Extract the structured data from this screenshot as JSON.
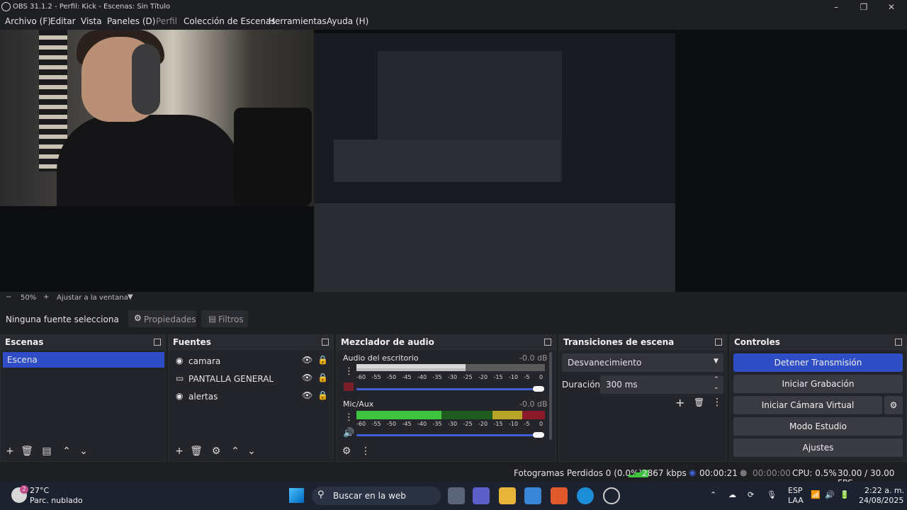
{
  "window": {
    "title": "OBS 31.1.2 - Perfil: Kick - Escenas: Sin Título"
  },
  "menu": [
    "Archivo (F)",
    "Editar",
    "Vista",
    "Paneles (D)",
    "Perfil",
    "Colección de Escenas",
    "Herramientas",
    "Ayuda (H)"
  ],
  "zoom": {
    "minus": "−",
    "value": "50%",
    "plus": "+",
    "mode": "Ajustar a la ventana"
  },
  "source_bar": {
    "no_source": "Ninguna fuente selecciona",
    "properties": "Propiedades",
    "filters": "Filtros"
  },
  "scenes": {
    "title": "Escenas",
    "items": [
      "Escena"
    ]
  },
  "sources": {
    "title": "Fuentes",
    "items": [
      {
        "name": "camara",
        "icon": "camera-icon"
      },
      {
        "name": "PANTALLA GENERAL",
        "icon": "monitor-icon"
      },
      {
        "name": "alertas",
        "icon": "globe-icon"
      }
    ]
  },
  "mixer": {
    "title": "Mezclador de audio",
    "channels": [
      {
        "name": "Audio del escritorio",
        "db": "-0.0 dB",
        "level": 0.58
      },
      {
        "name": "Mic/Aux",
        "db": "-0.0 dB",
        "level": 0.45
      }
    ],
    "ticks": [
      "-60",
      "-55",
      "-50",
      "-45",
      "-40",
      "-35",
      "-30",
      "-25",
      "-20",
      "-15",
      "-10",
      "-5",
      "0"
    ]
  },
  "transitions": {
    "title": "Transiciones de escena",
    "selected": "Desvanecimiento",
    "duration_label": "Duración",
    "duration_value": "300 ms"
  },
  "controls": {
    "title": "Controles",
    "stop_stream": "Detener Transmisión",
    "start_record": "Iniciar Grabación",
    "start_vcam": "Iniciar Cámara Virtual",
    "studio_mode": "Modo Estudio",
    "settings": "Ajustes"
  },
  "status": {
    "dropped": "Fotogramas Perdidos 0 (0.0%)",
    "bitrate": "2867 kbps",
    "stream_time": "00:00:21",
    "rec_time": "00:00:00",
    "cpu": "CPU: 0.5%",
    "fps": "30.00 / 30.00 FPS"
  },
  "taskbar": {
    "weather_temp": "27°C",
    "weather_desc": "Parc. nublado",
    "weather_badge": "2",
    "search": "Buscar en la web",
    "lang": "ESP",
    "lang2": "LAA",
    "time": "2:22 a. m.",
    "date": "24/08/2025"
  },
  "colors": {
    "accent": "#2f4ec6",
    "panel": "#24252b",
    "meter_green": "#3ec43e",
    "meter_yellow": "#b8a528",
    "meter_red": "#8a1a2a"
  }
}
